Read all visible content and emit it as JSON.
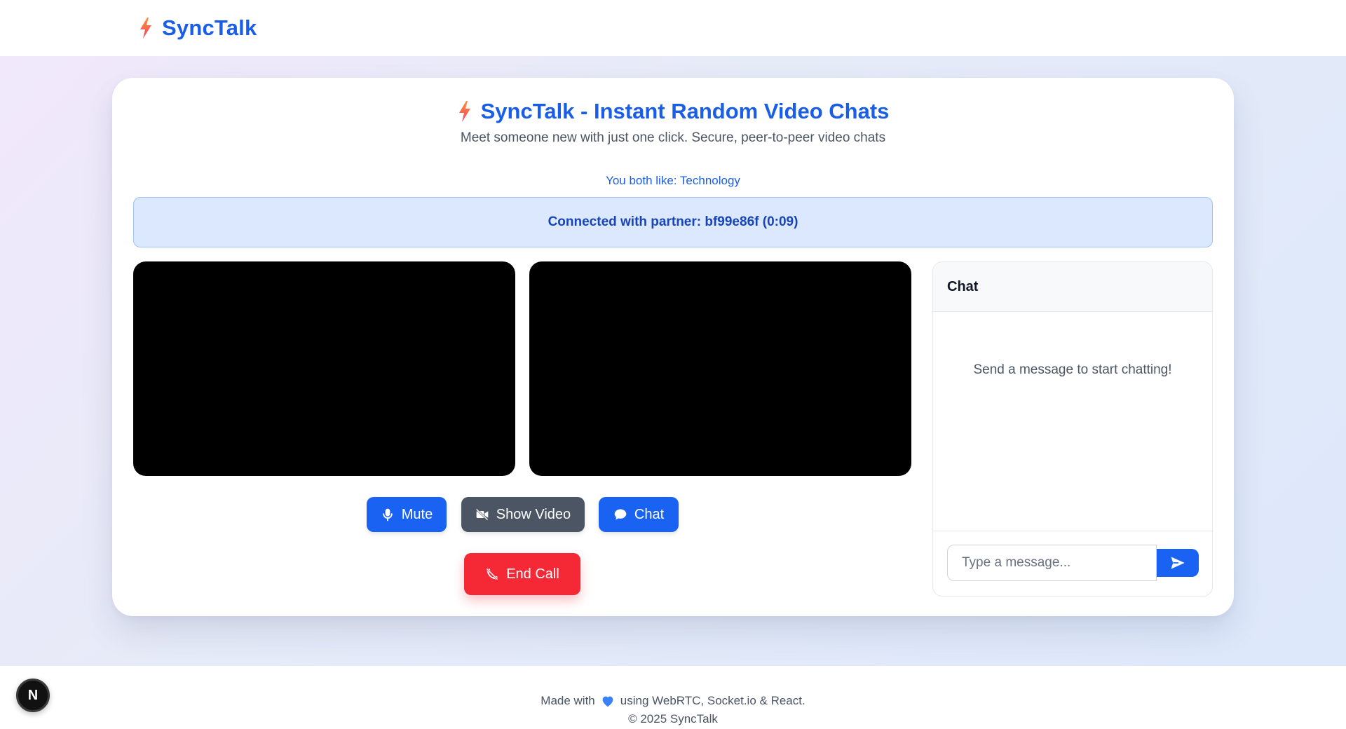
{
  "app": {
    "brand_name": "SyncTalk",
    "brand_icon": "lightning-bolt-icon",
    "colors": {
      "brand": "#1a5ee8",
      "primary_button": "#1a63f2",
      "secondary_button": "#4b5563",
      "danger_button": "#f52835",
      "status_bg": "#dbe8fe",
      "status_text": "#1745b8",
      "bolt": "#f97316"
    }
  },
  "main": {
    "heading": "SyncTalk - Instant Random Video Chats",
    "subtitle": "Meet someone new with just one click. Secure, peer-to-peer video chats",
    "shared_interests": "You both like: Technology",
    "status": "Connected with partner: bf99e86f (0:09)"
  },
  "controls": {
    "mute_label": "Mute",
    "mute_icon": "microphone-icon",
    "video_label": "Show Video",
    "video_icon": "video-off-icon",
    "chat_label": "Chat",
    "chat_icon": "chat-bubble-icon",
    "end_label": "End Call",
    "end_icon": "phone-hangup-icon"
  },
  "chat": {
    "title": "Chat",
    "empty_message": "Send a message to start chatting!",
    "input_placeholder": "Type a message...",
    "input_value": "",
    "send_icon": "send-icon"
  },
  "footer": {
    "made_with_prefix": "Made with",
    "heart_icon": "blue-heart-icon",
    "made_with_suffix": "using WebRTC, Socket.io & React.",
    "copyright": "© 2025 SyncTalk"
  },
  "dev_badge": {
    "label": "N",
    "icon": "nextjs-icon"
  }
}
